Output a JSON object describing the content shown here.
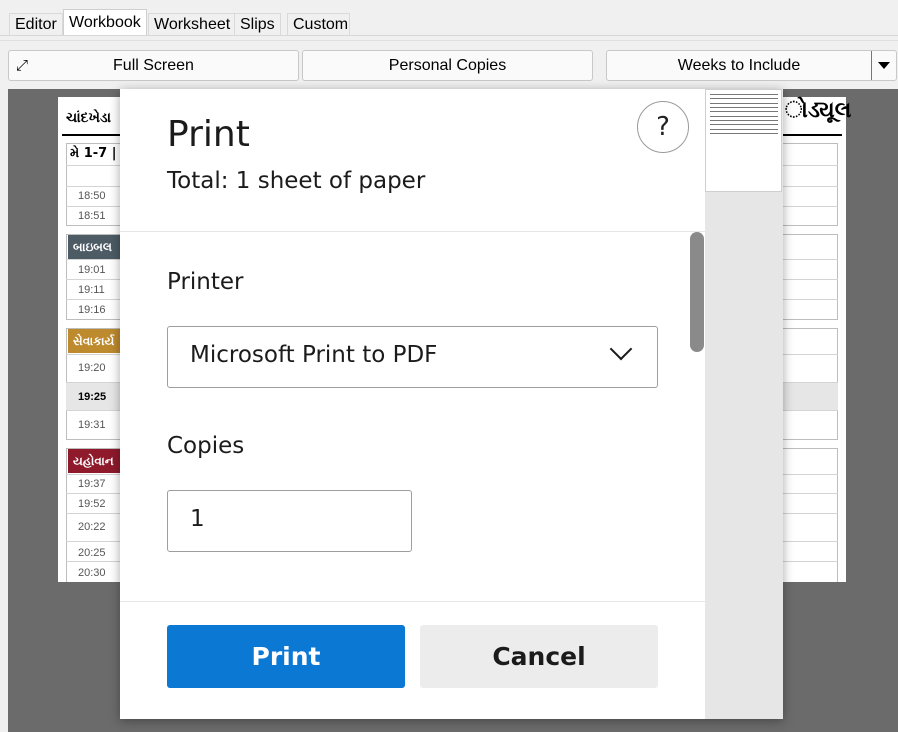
{
  "tabs": [
    {
      "label": "Editor",
      "active": false
    },
    {
      "label": "Workbook",
      "active": true
    },
    {
      "label": "Worksheet",
      "active": false
    },
    {
      "label": "Slips",
      "active": false
    },
    {
      "label": "Custom",
      "active": false
    }
  ],
  "toolbar": {
    "full_screen": "Full Screen",
    "personal_copies": "Personal Copies",
    "weeks_to_include": "Weeks to Include"
  },
  "sheet": {
    "title_left": "ચાંદખેડા",
    "title_right": "ોડ્યૂલ",
    "week_label": "મે 1-7 |",
    "sections": [
      {
        "label": "બાઇબલ",
        "color": "#4d5b65"
      },
      {
        "label": "સેવાકાર્ય",
        "color": "#be8a2e"
      },
      {
        "label": "યહોવાન",
        "color": "#8e1a2c"
      }
    ],
    "times": [
      "18:50",
      "18:51",
      "19:01",
      "19:11",
      "19:16",
      "19:20",
      "19:25",
      "19:31",
      "19:37",
      "19:52",
      "20:22",
      "20:25",
      "20:30"
    ]
  },
  "dialog": {
    "title": "Print",
    "subtitle": "Total: 1 sheet of paper",
    "help": "?",
    "printer_label": "Printer",
    "printer_value": "Microsoft Print to PDF",
    "copies_label": "Copies",
    "copies_value": "1",
    "print_button": "Print",
    "cancel_button": "Cancel"
  },
  "colors": {
    "accent": "#0b78d4",
    "preview_background": "#6b6b6b"
  },
  "icons": {
    "full_screen": "expand-icon",
    "dropdown": "chevron-down-icon",
    "help": "question-icon"
  }
}
